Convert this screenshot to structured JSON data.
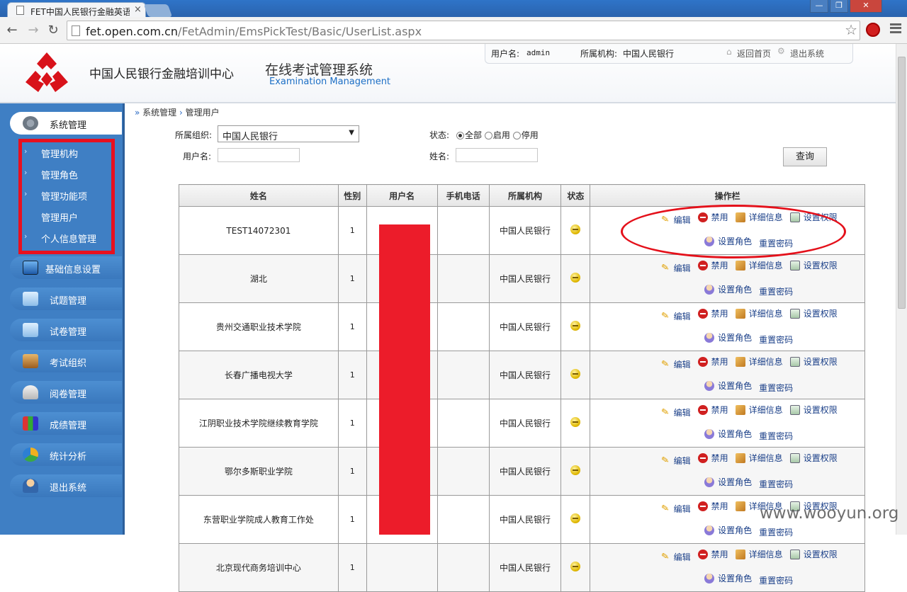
{
  "browser": {
    "tab_title": "FET中国人民银行金融英语",
    "tab_close": "×",
    "url_host": "fet.open.com.cn",
    "url_path": "/FetAdmin/EmsPickTest/Basic/UserList.aspx",
    "window_buttons": [
      "—",
      "❐",
      "✕"
    ]
  },
  "header": {
    "org_name": "中国人民银行金融培训中心",
    "system_title": "在线考试管理系统",
    "system_subtitle": "Examination Management",
    "user_label": "用户名:",
    "user_value": "admin",
    "dept_label": "所属机构:",
    "dept_value": "中国人民银行",
    "home_link": "返回首页",
    "logout_link": "退出系统"
  },
  "sidebar": {
    "active": "系统管理",
    "sub_items": [
      "管理机构",
      "管理角色",
      "管理功能项",
      "管理用户",
      "个人信息管理"
    ],
    "items": [
      "基础信息设置",
      "试题管理",
      "试卷管理",
      "考试组织",
      "阅卷管理",
      "成绩管理",
      "统计分析",
      "退出系统"
    ]
  },
  "breadcrumb": {
    "level1": "系统管理",
    "level2": "管理用户"
  },
  "filters": {
    "org_label": "所属组织:",
    "org_value": "中国人民银行",
    "status_label": "状态:",
    "status_options": [
      "全部",
      "启用",
      "停用"
    ],
    "status_selected": "全部",
    "username_label": "用户名:",
    "username_value": "",
    "name_label": "姓名:",
    "name_value": "",
    "query_button": "查询"
  },
  "table": {
    "headers": [
      "姓名",
      "性别",
      "用户名",
      "手机电话",
      "所属机构",
      "状态",
      "操作栏"
    ],
    "rows": [
      {
        "name": "TEST14072301",
        "gender": "1",
        "username": "",
        "phone": "",
        "org": "中国人民银行"
      },
      {
        "name": "湖北",
        "gender": "1",
        "username": "",
        "phone": "",
        "org": "中国人民银行"
      },
      {
        "name": "贵州交通职业技术学院",
        "gender": "1",
        "username": "",
        "phone": "",
        "org": "中国人民银行"
      },
      {
        "name": "长春广播电视大学",
        "gender": "1",
        "username": "",
        "phone": "",
        "org": "中国人民银行"
      },
      {
        "name": "江阴职业技术学院继续教育学院",
        "gender": "1",
        "username": "",
        "phone": "",
        "org": "中国人民银行"
      },
      {
        "name": "鄂尔多斯职业学院",
        "gender": "1",
        "username": "",
        "phone": "",
        "org": "中国人民银行"
      },
      {
        "name": "东营职业学院成人教育工作处",
        "gender": "1",
        "username": "",
        "phone": "",
        "org": "中国人民银行"
      },
      {
        "name": "北京现代商务培训中心",
        "gender": "1",
        "username": "",
        "phone": "",
        "org": "中国人民银行"
      }
    ],
    "actions": {
      "edit": "编辑",
      "disable": "禁用",
      "detail": "详细信息",
      "permission": "设置权限",
      "role": "设置角色",
      "reset": "重置密码"
    }
  },
  "watermark": "www.wooyun.org",
  "colors": {
    "sidebar": "#3f7fc4",
    "annotation_red": "#e8101f",
    "link": "#1a3f88",
    "brand_blue": "#1d6fc5"
  }
}
